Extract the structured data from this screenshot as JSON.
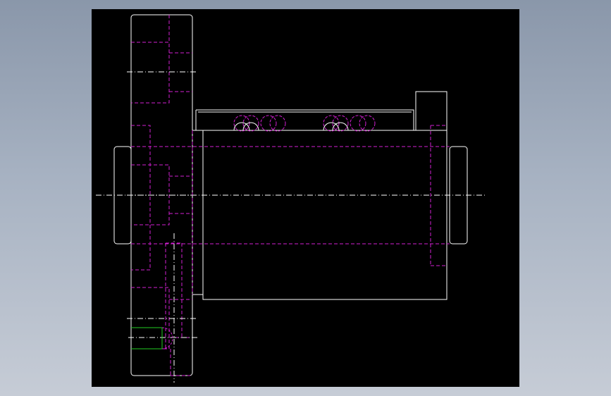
{
  "window": {
    "background_top": "#8a97aa",
    "background_bottom": "#c6ccd6",
    "viewport_background": "#000000"
  },
  "drawing": {
    "type": "cad-orthographic-view",
    "subject": "ball-screw-nut-assembly",
    "colors": {
      "visible_edge": "#ffffff",
      "hidden_edge": "#d21fd2",
      "center_line": "#ffffff",
      "highlight_edge": "#22cc22"
    },
    "view_count": 1
  }
}
